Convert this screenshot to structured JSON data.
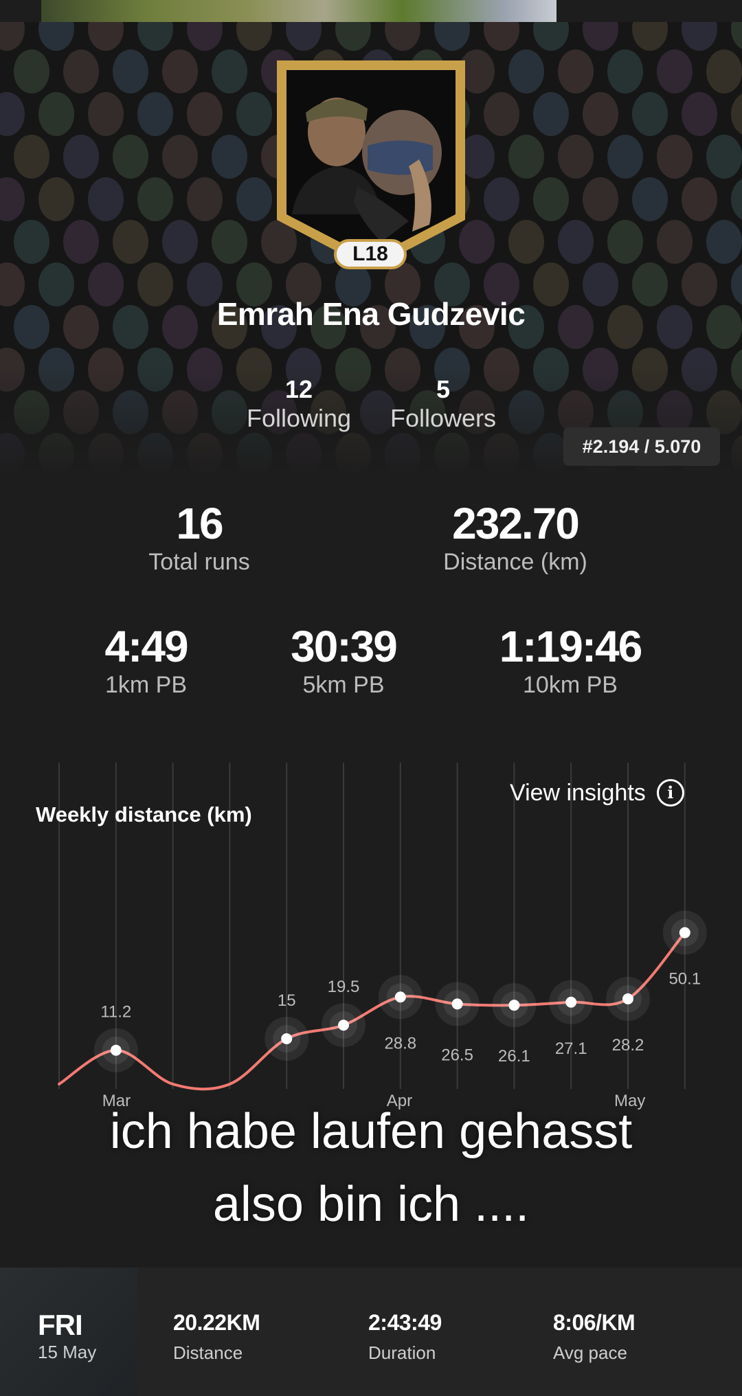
{
  "profile": {
    "level": "L18",
    "name": "Emrah Ena Gudzevic",
    "following_count": "12",
    "following_label": "Following",
    "followers_count": "5",
    "followers_label": "Followers",
    "rank": "#2.194 / 5.070"
  },
  "stats": {
    "total_runs": {
      "value": "16",
      "label": "Total runs"
    },
    "distance": {
      "value": "232.70",
      "label": "Distance (km)"
    },
    "pb_1km": {
      "value": "4:49",
      "label": "1km PB"
    },
    "pb_5km": {
      "value": "30:39",
      "label": "5km PB"
    },
    "pb_10km": {
      "value": "1:19:46",
      "label": "10km PB"
    }
  },
  "insights_label": "View insights",
  "chart_data": {
    "type": "line",
    "title": "Weekly distance (km)",
    "x_labels": [
      "Mar",
      "Apr",
      "May"
    ],
    "points": [
      {
        "week": 1,
        "value": 11.2,
        "label": "11.2"
      },
      {
        "week": 2,
        "value": 0
      },
      {
        "week": 3,
        "value": 0
      },
      {
        "week": 4,
        "value": 15,
        "label": "15"
      },
      {
        "week": 5,
        "value": 19.5,
        "label": "19.5"
      },
      {
        "week": 6,
        "value": 28.8,
        "label": "28.8"
      },
      {
        "week": 7,
        "value": 26.5,
        "label": "26.5"
      },
      {
        "week": 8,
        "value": 26.1,
        "label": "26.1"
      },
      {
        "week": 9,
        "value": 27.1,
        "label": "27.1"
      },
      {
        "week": 10,
        "value": 28.2,
        "label": "28.2"
      },
      {
        "week": 11,
        "value": 50.1,
        "label": "50.1"
      }
    ],
    "line_color": "#f27a72"
  },
  "caption": {
    "line1": "ich habe laufen gehasst",
    "line2": "also bin ich ...."
  },
  "last_activity": {
    "day": "FRI",
    "date": "15 May",
    "distance": "20.22KM",
    "distance_label": "Distance",
    "duration": "2:43:49",
    "duration_label": "Duration",
    "pace": "8:06/KM",
    "pace_label": "Avg pace"
  }
}
